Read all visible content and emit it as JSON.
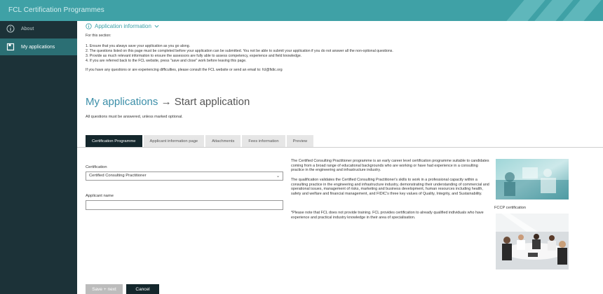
{
  "app": {
    "title": "FCL Certification Programmes"
  },
  "sidebar": {
    "items": [
      {
        "label": "About",
        "icon": "info-icon"
      },
      {
        "label": "My applications",
        "icon": "document-icon"
      }
    ]
  },
  "info": {
    "heading": "Application information",
    "intro": "For this section:",
    "points": [
      "1. Ensure that you always save your application as you go along.",
      "2. The questions listed on this page must be completed before your application can be submitted. You not be able to submit your application if you do not answer all the non-optional questions.",
      "3. Provide as much relevant information to ensure the assessors are fully able to assess competency, experience and field knowledge.",
      "4. If you are referred back to the FCL website, press \"save and close\" work before leaving this page."
    ],
    "contact": "If you have any questions or are experiencing difficulties, please consult the FCL website or send an email to: fcl@fidic.org"
  },
  "page": {
    "title": "My applications",
    "arrow": "→",
    "subtitle": "Start application",
    "note": "All questions must be answered, unless marked optional."
  },
  "tabs": [
    {
      "label": "Certification Programme",
      "active": true
    },
    {
      "label": "Applicant information page",
      "active": false
    },
    {
      "label": "Attachments",
      "active": false
    },
    {
      "label": "Fees information",
      "active": false
    },
    {
      "label": "Preview",
      "active": false
    }
  ],
  "form": {
    "certification_label": "Certification",
    "certification_value": "Certified Consulting Practitioner",
    "applicant_label": "Applicant name",
    "applicant_value": ""
  },
  "description": {
    "p1": "The Certified Consulting Practitioner programme is an early career level certification programme suitable to candidates coming from a broad range of educational backgrounds who are working or have had experience in a consulting practice in the engineering and infrastructure industry.",
    "p2": "The qualification validates the Certified Consulting Practitioner's skills to work in a professional capacity within a consulting practice in the engineering and infrastructure industry, demonstrating their understanding of commercial and operational issues, management of risks, marketing and business development, human resources including health, safety and welfare and financial management, and FIDIC's three key values of Quality, Integrity, and Sustainability.",
    "p3": "*Please note that FCL does not provide training. FCL provides certification to already qualified individuals who have experience and practical industry knowledge in their area of specialisation."
  },
  "images": {
    "caption": "FCCP certification"
  },
  "buttons": {
    "save_next": "Save + next",
    "cancel": "Cancel"
  },
  "colors": {
    "teal": "#3fa1a6",
    "dark": "#14272c",
    "sidebar": "#1c3238",
    "active_item": "#2b6f74",
    "link": "#3b8ea8"
  }
}
